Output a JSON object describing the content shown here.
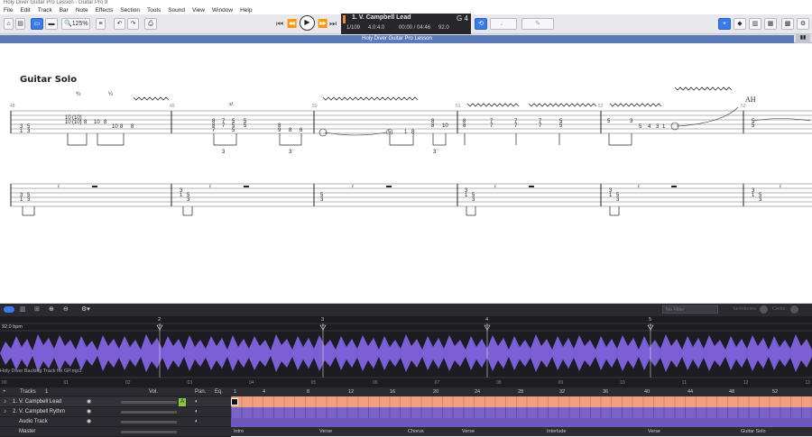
{
  "window": {
    "title": "Holy Diver Guitar Pro Lesson - Guitar Pro 8"
  },
  "menu": [
    "File",
    "Edit",
    "Track",
    "Bar",
    "Note",
    "Effects",
    "Section",
    "Tools",
    "Sound",
    "View",
    "Window",
    "Help"
  ],
  "toolbar": {
    "zoom": "125%"
  },
  "lcd": {
    "track": "1. V. Campbell Lead",
    "position": "1/109",
    "signature": "4.0:4.0",
    "time": "00:00 / 04:46",
    "tempo": "92.0",
    "key": "G 4"
  },
  "document_tab": "Holy Diver Guitar Pro Lesson",
  "score": {
    "section_title": "Guitar Solo",
    "bars": [
      "48",
      "49",
      "50",
      "51",
      "52",
      "53"
    ],
    "annotations": [
      "¾",
      "¼",
      "AH",
      "sl."
    ],
    "triplet_label": "3"
  },
  "panel": {
    "filter_placeholder": "No Filter",
    "semitones_label": "Semitones:",
    "cents_label": "Cents:"
  },
  "timeline": {
    "bpm": "92.0 bpm",
    "markers": [
      "2",
      "3",
      "4",
      "5"
    ],
    "audio_file": "Holy Diver Backing Track for GP.mp3",
    "ruler": [
      "00",
      "01",
      "02",
      "03",
      "04",
      "05",
      "06",
      "07",
      "08",
      "09",
      "10",
      "11",
      "12",
      "13"
    ]
  },
  "tracks_header": {
    "label": "Tracks",
    "count": "1",
    "vol": "Vol.",
    "pan": "Pan.",
    "eq": "Eq."
  },
  "tracks": [
    {
      "num": "1.",
      "name": "V. Campbell Lead"
    },
    {
      "num": "2.",
      "name": "V. Campbell Rythm"
    },
    {
      "num": "",
      "name": "Audio Track"
    },
    {
      "num": "",
      "name": "Master"
    }
  ],
  "bar_numbers": [
    "1",
    "4",
    "8",
    "12",
    "16",
    "20",
    "24",
    "28",
    "32",
    "36",
    "40",
    "44",
    "48",
    "52"
  ],
  "sections": [
    "Intro",
    "Verse",
    "Chorus",
    "Verse",
    "Interlude",
    "Verse",
    "Guitar Solo"
  ],
  "colors": {
    "lead": "#f0a080",
    "rhythm": "#7a62c8",
    "accent": "#3b7be8",
    "wave": "#7a5fd6"
  }
}
